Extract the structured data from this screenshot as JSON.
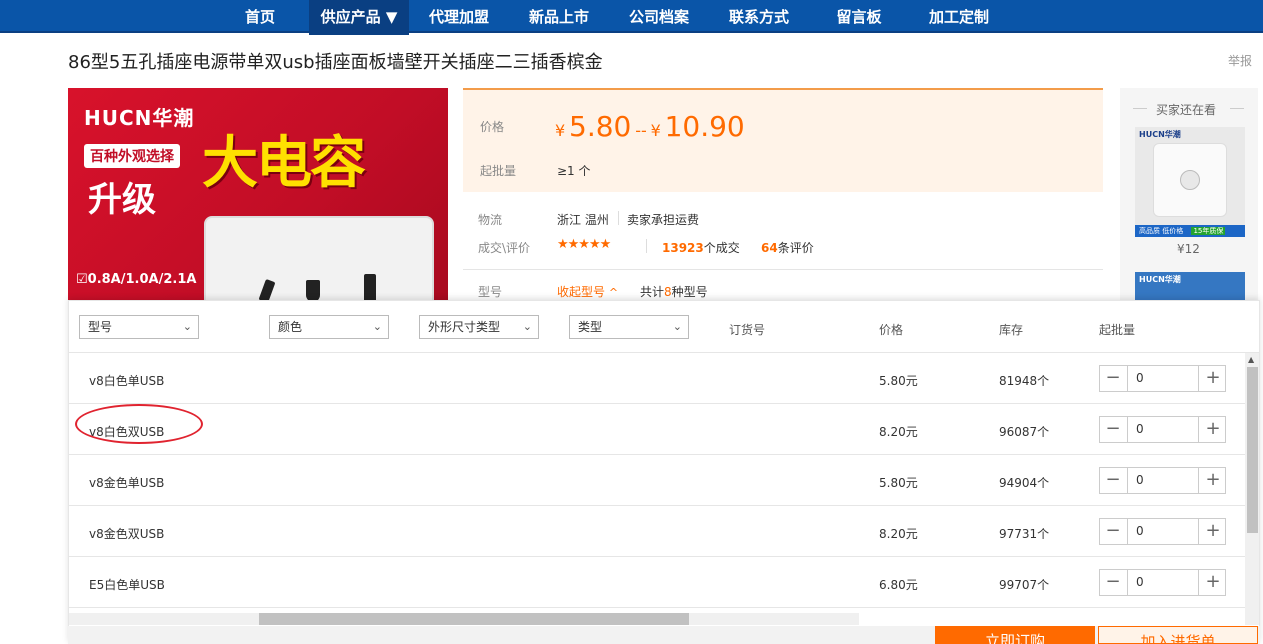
{
  "nav": [
    {
      "label": "首页",
      "active": false
    },
    {
      "label": "供应产品 ▼",
      "active": true
    },
    {
      "label": "代理加盟",
      "active": false
    },
    {
      "label": "新品上市",
      "active": false
    },
    {
      "label": "公司档案",
      "active": false
    },
    {
      "label": "联系方式",
      "active": false
    },
    {
      "label": "留言板",
      "active": false
    },
    {
      "label": "加工定制",
      "active": false
    }
  ],
  "product": {
    "title": "86型5五孔插座电源带单双usb插座面板墙壁开关插座二三插香槟金",
    "report": "举报"
  },
  "image": {
    "logo": "HUCN华潮",
    "tag1": "百种外观选择",
    "tag2": "升级",
    "headline": "大电容",
    "spec": "☑0.8A/1.0A/2.1A"
  },
  "price": {
    "label": "价格",
    "currency": "¥",
    "low": "5.80",
    "sep": "--",
    "high": "10.90",
    "moq_label": "起批量",
    "moq": "≥1 个"
  },
  "logistics": {
    "label": "物流",
    "origin": "浙江 温州",
    "shipping": "卖家承担运费"
  },
  "deals": {
    "label": "成交\\评价",
    "stars": "★★★★★",
    "count": "13923",
    "count_suffix": "个成交",
    "reviews": "64",
    "reviews_suffix": "条评价"
  },
  "model": {
    "label": "型号",
    "collapse": "收起型号",
    "chevron": "^",
    "total_prefix": "共计",
    "total": "8",
    "total_suffix": "种型号"
  },
  "sidebar": {
    "title": "买家还在看",
    "item_price": "¥12",
    "thumb_badge": "高品质 低价格",
    "thumb_badge2": "15年质保"
  },
  "table": {
    "filters": [
      "型号",
      "颜色",
      "外形尺寸类型",
      "类型"
    ],
    "headers": {
      "order_no": "订货号",
      "price": "价格",
      "stock": "库存",
      "moq": "起批量"
    },
    "rows": [
      {
        "model": "v8白色单USB",
        "price": "5.80元",
        "stock": "81948个",
        "qty": "0"
      },
      {
        "model": "v8白色双USB",
        "price": "8.20元",
        "stock": "96087个",
        "qty": "0"
      },
      {
        "model": "v8金色单USB",
        "price": "5.80元",
        "stock": "94904个",
        "qty": "0"
      },
      {
        "model": "v8金色双USB",
        "price": "8.20元",
        "stock": "97731个",
        "qty": "0"
      },
      {
        "model": "E5白色单USB",
        "price": "6.80元",
        "stock": "99707个",
        "qty": "0"
      }
    ],
    "minus": "−",
    "plus": "+"
  },
  "actions": {
    "buy": "立即订购",
    "cart": "加入进货单"
  }
}
